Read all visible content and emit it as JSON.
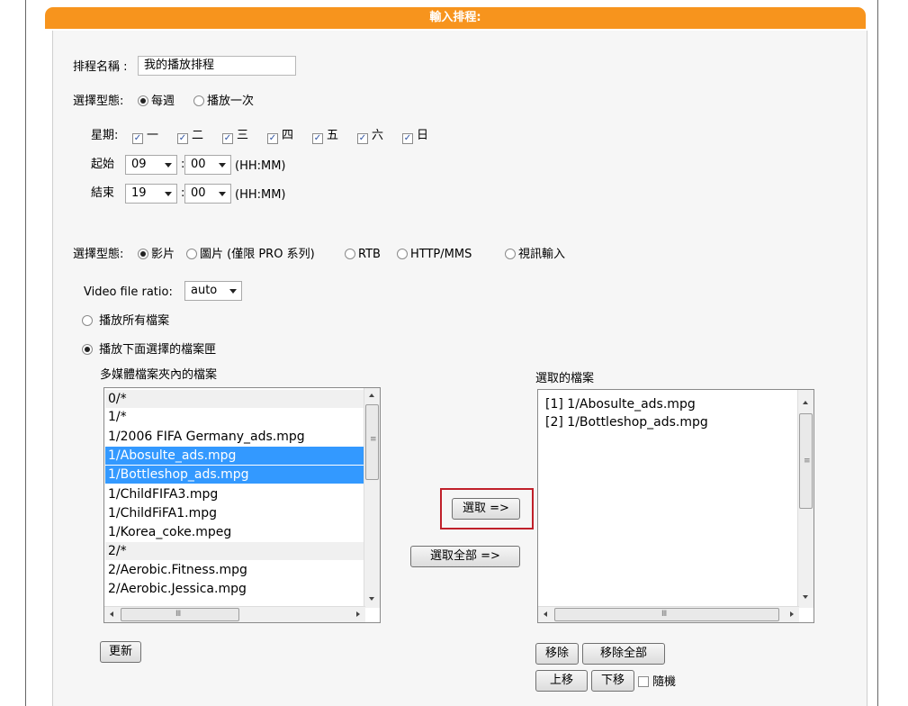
{
  "header": {
    "title": "輸入排程:"
  },
  "schedule_name": {
    "label": "排程名稱 :",
    "value": "我的播放排程"
  },
  "schedule_type": {
    "label": "選擇型態:",
    "options": [
      "每週",
      "播放一次"
    ],
    "selected": "每週"
  },
  "weekdays": {
    "label": "星期:",
    "days": [
      "一",
      "二",
      "三",
      "四",
      "五",
      "六",
      "日"
    ],
    "checked": [
      true,
      true,
      true,
      true,
      true,
      true,
      true
    ]
  },
  "start": {
    "label": "起始",
    "hour": "09",
    "sep": ":",
    "minute": "00",
    "format": "(HH:MM)"
  },
  "end": {
    "label": "結束",
    "hour": "19",
    "sep": ":",
    "minute": "00",
    "format": "(HH:MM)"
  },
  "media_type": {
    "label": "選擇型態:",
    "options": [
      "影片",
      "圖片 (僅限 PRO 系列)",
      "RTB",
      "HTTP/MMS",
      "視訊輸入"
    ],
    "selected": "影片"
  },
  "video_ratio": {
    "label": "Video file ratio:",
    "value": "auto"
  },
  "play_mode": {
    "options": [
      "播放所有檔案",
      "播放下面選擇的檔案匣"
    ],
    "selected": "播放下面選擇的檔案匣"
  },
  "source_list": {
    "label": "多媒體檔案夾內的檔案",
    "items": [
      "0/*",
      "1/*",
      "1/2006 FIFA Germany_ads.mpg",
      "1/Abosulte_ads.mpg",
      "1/Bottleshop_ads.mpg",
      "1/ChildFIFA3.mpg",
      "1/ChildFiFA1.mpg",
      "1/Korea_coke.mpeg",
      "2/*",
      "2/Aerobic.Fitness.mpg",
      "2/Aerobic.Jessica.mpg"
    ],
    "highlighted": [
      "1/Abosulte_ads.mpg",
      "1/Bottleshop_ads.mpg"
    ],
    "grouped": [
      "0/*",
      "1/*",
      "2/*"
    ]
  },
  "selected_list": {
    "label": "選取的檔案",
    "items": [
      "[1] 1/Abosulte_ads.mpg",
      "[2] 1/Bottleshop_ads.mpg"
    ]
  },
  "buttons": {
    "select": "選取 =>",
    "select_all": "選取全部 =>",
    "refresh": "更新",
    "remove": "移除",
    "remove_all": "移除全部",
    "move_up": "上移",
    "move_down": "下移"
  },
  "random": {
    "label": "隨機",
    "checked": false
  },
  "colors": {
    "accent": "#f7941d",
    "highlight": "#3399ff",
    "callout": "#c0202a"
  }
}
